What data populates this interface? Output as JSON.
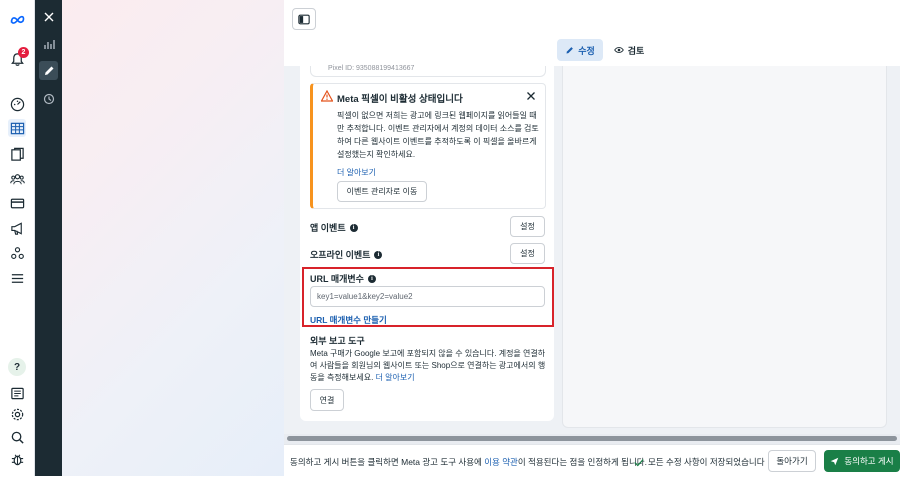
{
  "header": {
    "tab_edit": "수정",
    "tab_review": "검토"
  },
  "rail": {
    "notification_count": "2",
    "help_label": "?"
  },
  "pixel": {
    "id_text": "Pixel ID: 935088199413667"
  },
  "alert": {
    "title": "Meta 픽셀이 비활성 상태입니다",
    "body": "픽셀이 없으면 저희는 광고에 링크된 웹페이지를 읽어들일 때만 추적합니다. 이벤트 관리자에서 계정의 데이터 소스를 검토하여 다른 웹사이트 이벤트를 추적하도록 이 픽셀을 올바르게 설정했는지 확인하세요.",
    "learn_more": "더 알아보기",
    "button": "이벤트 관리자로 이동"
  },
  "app_events": {
    "label": "앱 이벤트",
    "button": "설정"
  },
  "offline_events": {
    "label": "오프라인 이벤트",
    "button": "설정"
  },
  "url_params": {
    "label": "URL 매개변수",
    "placeholder": "key1=value1&key2=value2",
    "link": "URL 매개변수 만들기"
  },
  "external": {
    "title": "외부 보고 도구",
    "body": "Meta 구매가 Google 보고에 포함되지 않을 수 있습니다. 계정을 연결하여 사람들을 회원님의 웹사이트 또는 Shop으로 연결하는 광고에서의 행동을 측정해보세요.",
    "learn_more": "더 알아보기",
    "button": "연결"
  },
  "footer": {
    "text_before": "동의하고 게시 버튼을 클릭하면 Meta 광고 도구 사용에 ",
    "terms_link": "이용 약관",
    "text_after": "이 적용된다는 점을 인정하게 됩니다.",
    "saved_status": "모든 수정 사항이 저장되었습니다",
    "back_button": "돌아가기",
    "publish_button": "동의하고 게시"
  },
  "colors": {
    "accent": "#1b5fb0",
    "publish": "#1a7f47",
    "warning": "#f7931e",
    "highlight": "#d8232a"
  }
}
